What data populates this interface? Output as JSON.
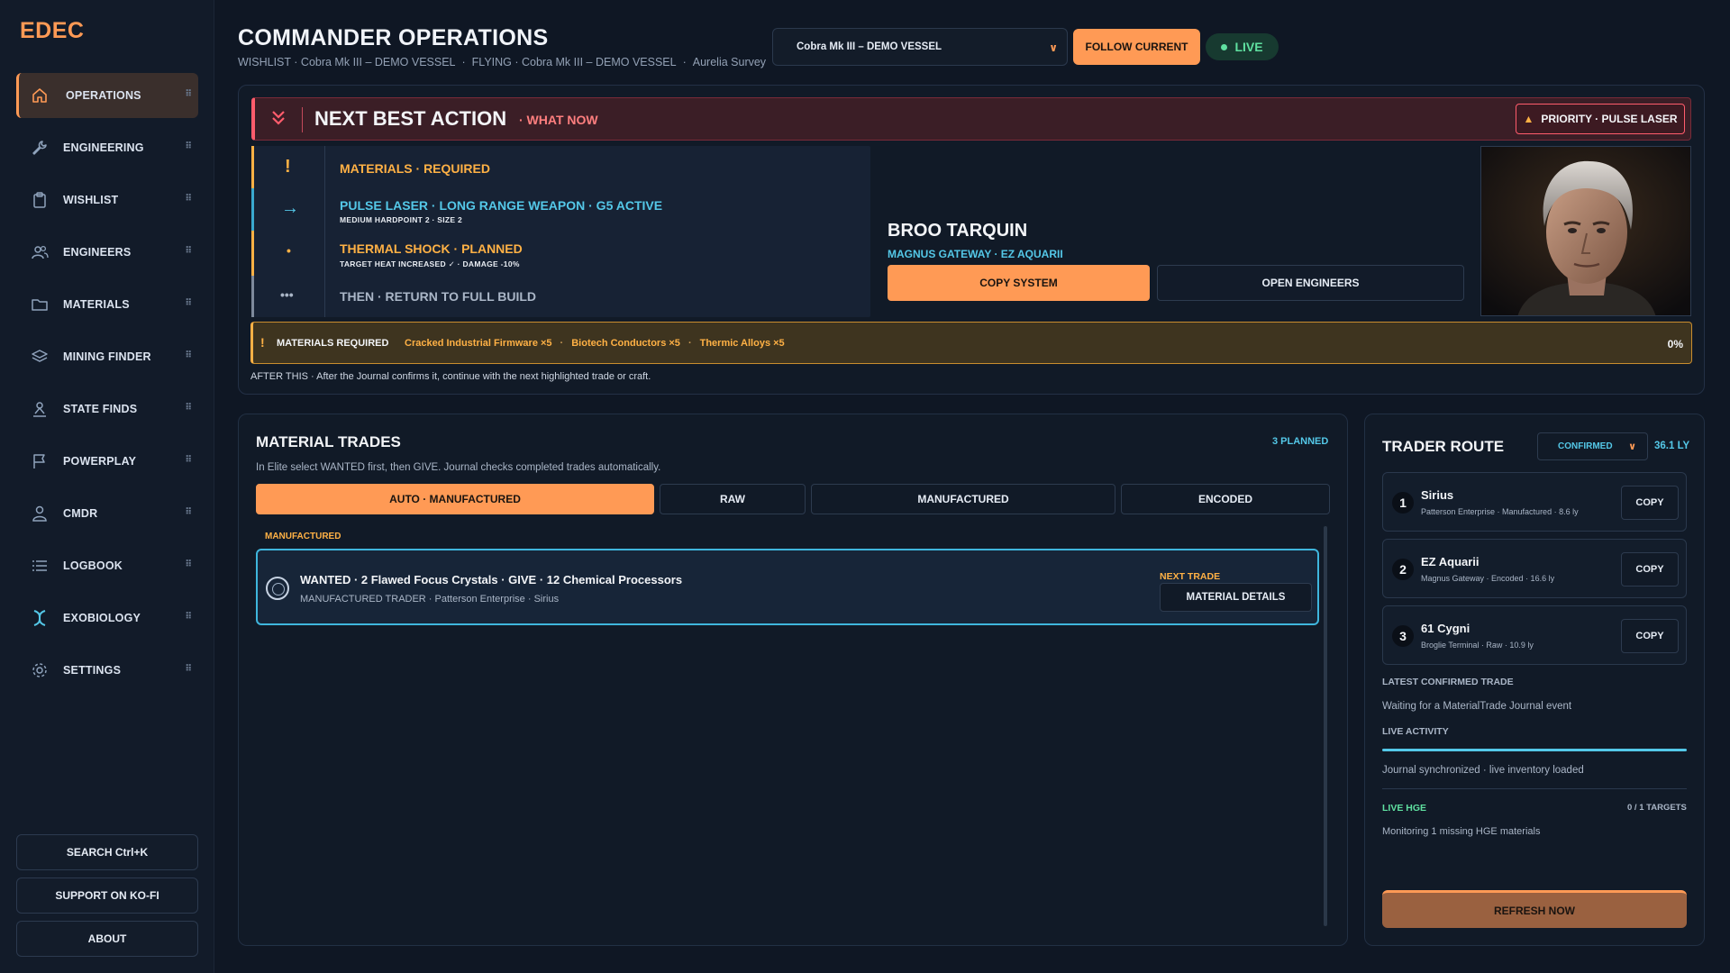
{
  "app": {
    "brand": "EDEC"
  },
  "sidebar": {
    "items": [
      {
        "label": "OPERATIONS",
        "icon": "home-icon",
        "active": true
      },
      {
        "label": "ENGINEERING",
        "icon": "wrench-icon"
      },
      {
        "label": "WISHLIST",
        "icon": "clipboard-icon"
      },
      {
        "label": "ENGINEERS",
        "icon": "users-icon"
      },
      {
        "label": "MATERIALS",
        "icon": "folder-icon"
      },
      {
        "label": "MINING FINDER",
        "icon": "layers-icon"
      },
      {
        "label": "STATE FINDS",
        "icon": "person-pin-icon"
      },
      {
        "label": "POWERPLAY",
        "icon": "flag-icon"
      },
      {
        "label": "CMDR",
        "icon": "user-icon"
      },
      {
        "label": "LOGBOOK",
        "icon": "list-icon"
      },
      {
        "label": "EXOBIOLOGY",
        "icon": "dna-icon"
      },
      {
        "label": "SETTINGS",
        "icon": "gear-icon"
      }
    ],
    "search_label": "SEARCH  Ctrl+K",
    "support_label": "SUPPORT ON KO-FI",
    "about_label": "ABOUT"
  },
  "header": {
    "title": "COMMANDER OPERATIONS",
    "wishlist": "WISHLIST · Cobra Mk III – DEMO VESSEL",
    "flying": "FLYING · Cobra Mk III – DEMO VESSEL",
    "survey": "Aurelia Survey",
    "vessel_select": "Cobra Mk III – DEMO VESSEL",
    "follow_label": "FOLLOW CURRENT",
    "live_label": "LIVE"
  },
  "nba": {
    "title": "NEXT BEST ACTION",
    "subtitle": "· WHAT NOW",
    "priority_label": "PRIORITY · PULSE LASER",
    "steps": [
      {
        "icon": "!",
        "main": "MATERIALS · REQUIRED",
        "small": ""
      },
      {
        "icon": "→",
        "main": "PULSE LASER · LONG RANGE WEAPON · G5 ACTIVE",
        "small": "MEDIUM HARDPOINT 2 · SIZE 2"
      },
      {
        "icon": "•",
        "main": "THERMAL SHOCK · PLANNED",
        "small": "TARGET HEAT INCREASED ✓   ·   DAMAGE -10%"
      },
      {
        "icon": "•••",
        "main": "THEN · RETURN TO FULL BUILD",
        "small": ""
      }
    ],
    "engineer_name": "BROO TARQUIN",
    "engineer_location": "MAGNUS GATEWAY · EZ AQUARII",
    "copy_system_label": "COPY SYSTEM",
    "open_engineers_label": "OPEN ENGINEERS",
    "materials_required_label": "MATERIALS REQUIRED",
    "materials": [
      "Cracked Industrial Firmware ×5",
      "Biotech Conductors ×5",
      "Thermic Alloys ×5"
    ],
    "progress_pct": "0%",
    "after_this": "AFTER THIS · After the Journal confirms it, continue with the next highlighted trade or craft."
  },
  "trades": {
    "title": "MATERIAL TRADES",
    "planned": "3 PLANNED",
    "desc": "In Elite select WANTED first, then GIVE. Journal checks completed trades automatically.",
    "tabs": [
      "AUTO · MANUFACTURED",
      "RAW",
      "MANUFACTURED",
      "ENCODED"
    ],
    "group_label": "MANUFACTURED",
    "row": {
      "line": "WANTED · 2 Flawed Focus Crystals · GIVE · 12 Chemical Processors",
      "sub": "MANUFACTURED TRADER · Patterson Enterprise · Sirius",
      "next_label": "NEXT TRADE",
      "details_label": "MATERIAL DETAILS"
    }
  },
  "route": {
    "title": "TRADER ROUTE",
    "select": "CONFIRMED",
    "distance": "36.1 LY",
    "stops": [
      {
        "num": "1",
        "name": "Sirius",
        "detail": "Patterson Enterprise · Manufactured · 8.6 ly",
        "copy": "COPY"
      },
      {
        "num": "2",
        "name": "EZ Aquarii",
        "detail": "Magnus Gateway · Encoded · 16.6 ly",
        "copy": "COPY"
      },
      {
        "num": "3",
        "name": "61 Cygni",
        "detail": "Broglie Terminal · Raw · 10.9 ly",
        "copy": "COPY"
      }
    ],
    "latest_label": "LATEST CONFIRMED TRADE",
    "latest_text": "Waiting for a MaterialTrade Journal event",
    "activity_label": "LIVE ACTIVITY",
    "activity_text": "Journal synchronized · live inventory loaded",
    "hge_label": "LIVE HGE",
    "hge_count": "0 / 1 TARGETS",
    "hge_text": "Monitoring 1 missing HGE materials",
    "refresh_label": "REFRESH NOW"
  },
  "colors": {
    "accent": "#ff9a55",
    "cyan": "#54c8e8",
    "warning": "#ffb145",
    "danger": "#ff5c6c",
    "live": "#5fe0a0"
  }
}
